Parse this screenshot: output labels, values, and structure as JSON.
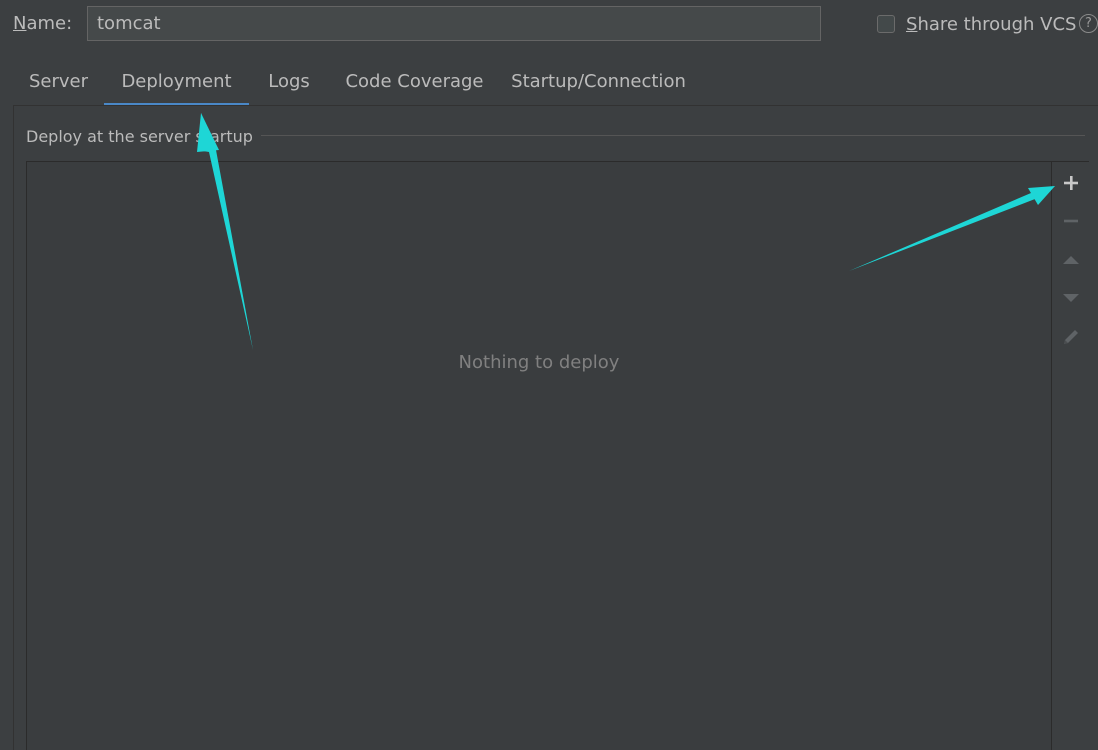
{
  "name_row": {
    "label_mnemonic": "N",
    "label_rest": "ame:",
    "value": "tomcat"
  },
  "vcs": {
    "checked": false,
    "label_mnemonic": "S",
    "label_rest": "hare through VCS",
    "help_glyph": "?"
  },
  "tabs": [
    {
      "label": "Server",
      "active": false
    },
    {
      "label": "Deployment",
      "active": true
    },
    {
      "label": "Logs",
      "active": false
    },
    {
      "label": "Code Coverage",
      "active": false
    },
    {
      "label": "Startup/Connection",
      "active": false
    }
  ],
  "deploy_section": {
    "title": "Deploy at the server startup",
    "empty_text": "Nothing to deploy"
  },
  "toolbar": {
    "buttons": [
      {
        "name": "add-icon",
        "enabled": true
      },
      {
        "name": "remove-icon",
        "enabled": false
      },
      {
        "name": "move-up-icon",
        "enabled": false
      },
      {
        "name": "move-down-icon",
        "enabled": false
      },
      {
        "name": "edit-pencil-icon",
        "enabled": false
      }
    ]
  },
  "colors": {
    "background": "#3c3f41",
    "tab_underline": "#4a88c7",
    "annotation_arrow": "#1ed6d6",
    "enabled_icon": "#c8c8c8",
    "disabled_icon": "#5f6366"
  }
}
